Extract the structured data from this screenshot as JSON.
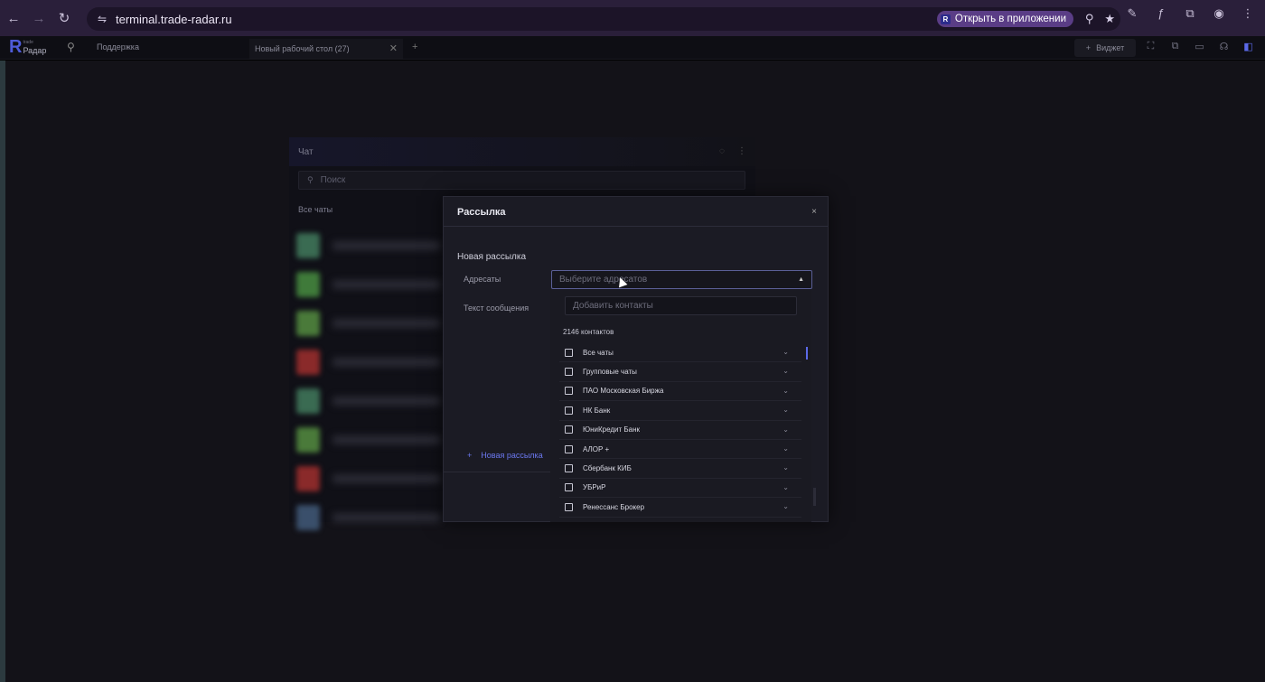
{
  "browser": {
    "url": "terminal.trade-radar.ru",
    "open_in_app": "Открыть в приложении",
    "nav_back": "←",
    "nav_forward": "→",
    "reload": "↻",
    "site_info_icon": "⇋",
    "zoom_icon": "⚲",
    "star_icon": "★",
    "tools": [
      "✎",
      "ƒ",
      "⧉",
      "◉",
      "⋮"
    ]
  },
  "app": {
    "logo_letter": "R",
    "logo_name": "Радар",
    "logo_sub": "trade",
    "search_icon": "⚲",
    "support": "Поддержка",
    "workspace_tab": "Новый рабочий стол (27)",
    "tab_close": "✕",
    "tab_add": "+",
    "widget_plus": "+",
    "widget_label": "Виджет",
    "icons": [
      "⛶",
      "⧉",
      "▭",
      "☊",
      "◧"
    ]
  },
  "chat": {
    "title": "Чат",
    "search_placeholder": "Поиск",
    "filter": "Все чаты",
    "rows": [
      {
        "color": "#3a6b52"
      },
      {
        "color": "#3f7a3a"
      },
      {
        "color": "#4a7a3a"
      },
      {
        "color": "#8a2a2a"
      },
      {
        "color": "#3a6b52"
      },
      {
        "color": "#4a7a3a"
      },
      {
        "color": "#8a2a2a"
      },
      {
        "color": "#3a4f6b"
      }
    ]
  },
  "modal": {
    "title": "Рассылка",
    "close": "×",
    "section_title": "Новая рассылка",
    "recipients_label": "Адресаты",
    "recipients_placeholder": "Выберите адресатов",
    "caret": "▲",
    "message_label": "Текст сообщения",
    "add_plus": "+",
    "add_mailing": "Новая рассылка"
  },
  "dropdown": {
    "search_placeholder": "Добавить контакты",
    "count": "2146 контактов",
    "chevron": "⌄",
    "items": [
      "Все чаты",
      "Групповые чаты",
      "ПАО Московская Биржа",
      "НК Банк",
      "ЮниКредит Банк",
      "АЛОР +",
      "Сбербанк КИБ",
      "УБРиР",
      "Ренессанс Брокер"
    ]
  }
}
